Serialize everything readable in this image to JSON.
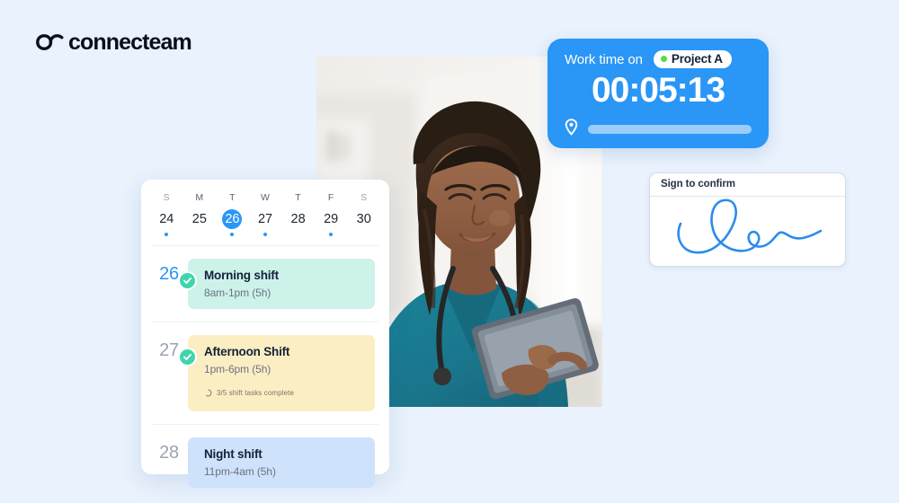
{
  "brand": {
    "name": "connecteam",
    "logo_icon": "infinity-loop-icon"
  },
  "background_color": "#e9f2fd",
  "photo": {
    "alt": "nurse-with-tablet-photo",
    "subject": "Smiling nurse in teal scrubs with stethoscope holding a tablet",
    "setting": "Blurred bright clinic interior"
  },
  "worktime_card": {
    "label": "Work time on",
    "project_name": "Project A",
    "project_status_color": "#5dd84a",
    "timer": "00:05:13",
    "accent_color": "#2a96f6",
    "location_icon": "map-pin-icon",
    "progress_bar_color": "#9ccdfa"
  },
  "signature_card": {
    "title": "Sign to confirm",
    "signature_icon": "handwritten-signature",
    "ink_color": "#2a8ced"
  },
  "calendar": {
    "week": [
      {
        "letter": "S",
        "date": "24",
        "has_dot": true,
        "active": false,
        "weekend": true
      },
      {
        "letter": "M",
        "date": "25",
        "has_dot": false,
        "active": false,
        "weekend": false
      },
      {
        "letter": "T",
        "date": "26",
        "has_dot": true,
        "active": true,
        "weekend": false
      },
      {
        "letter": "W",
        "date": "27",
        "has_dot": true,
        "active": false,
        "weekend": false
      },
      {
        "letter": "T",
        "date": "28",
        "has_dot": false,
        "active": false,
        "weekend": false
      },
      {
        "letter": "F",
        "date": "29",
        "has_dot": true,
        "active": false,
        "weekend": false
      },
      {
        "letter": "S",
        "date": "30",
        "has_dot": false,
        "active": false,
        "weekend": true
      }
    ],
    "selected_date": "26",
    "highlight_color": "#2a96f6",
    "shifts": [
      {
        "date": "26",
        "title": "Morning shift",
        "time": "8am-1pm (5h)",
        "color": "#cdf2ea",
        "confirmed": true,
        "is_today": true,
        "tasks": null
      },
      {
        "date": "27",
        "title": "Afternoon Shift",
        "time": "1pm-6pm (5h)",
        "color": "#fceec3",
        "confirmed": true,
        "is_today": false,
        "tasks": "3/5 shift tasks complete"
      },
      {
        "date": "28",
        "title": "Night shift",
        "time": "11pm-4am (5h)",
        "color": "#cfe2fb",
        "confirmed": false,
        "is_today": false,
        "tasks": null
      }
    ]
  }
}
